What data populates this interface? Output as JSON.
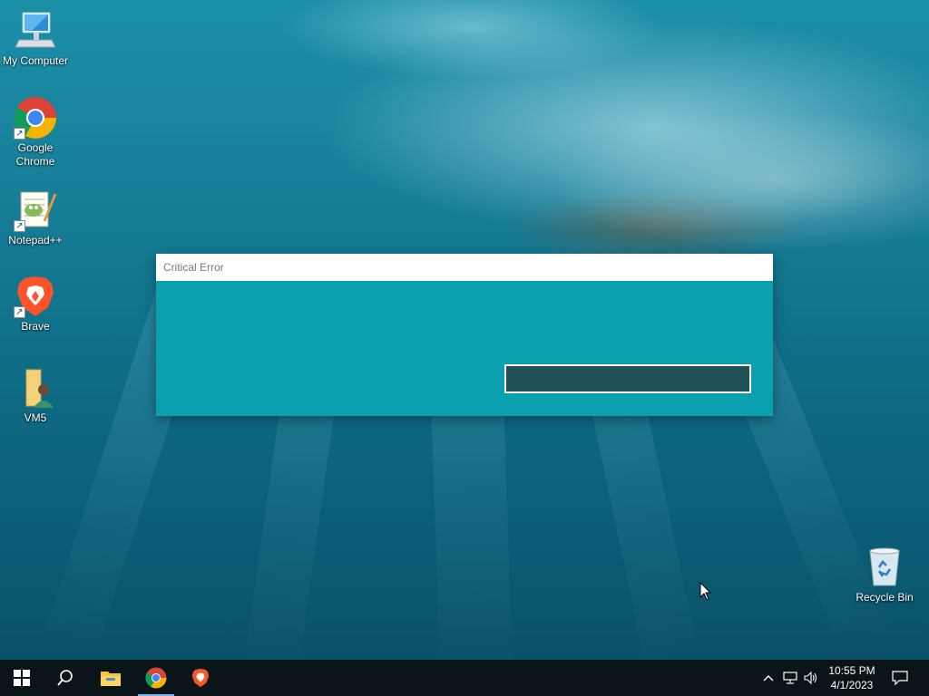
{
  "desktop": {
    "icons": [
      {
        "label": "My Computer"
      },
      {
        "label": "Google Chrome"
      },
      {
        "label": "Notepad++"
      },
      {
        "label": "Brave"
      },
      {
        "label": "VM5"
      },
      {
        "label": "Recycle Bin"
      }
    ]
  },
  "dialog": {
    "title": "Critical Error",
    "button_label": ""
  },
  "taskbar": {
    "start_icon": "windows-logo-icon",
    "search_icon": "search-icon",
    "pinned": [
      "file-explorer-icon",
      "chrome-icon",
      "brave-icon"
    ],
    "active_app": "chrome-icon",
    "tray": {
      "time": "10:55 PM",
      "date": "4/1/2023"
    }
  },
  "colors": {
    "dialog_body": "#0aa0ad",
    "dialog_button": "#1f4f57",
    "taskbar": "#0b1419",
    "active_indicator": "#76b9ed"
  }
}
